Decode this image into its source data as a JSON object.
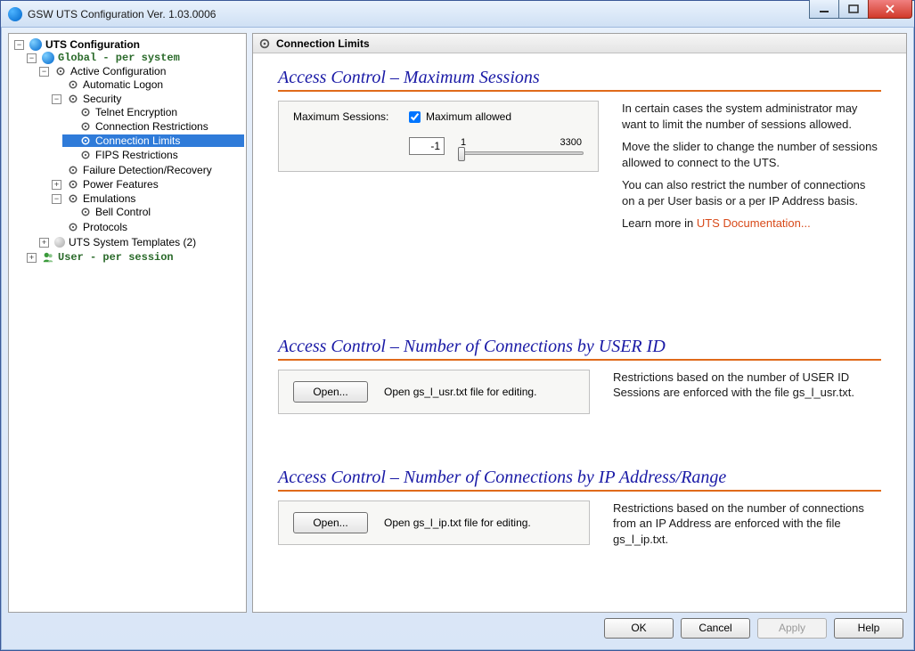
{
  "window": {
    "title": "GSW UTS Configuration     Ver. 1.03.0006"
  },
  "tree": {
    "root": "UTS Configuration",
    "global": "Global  - per system",
    "active_config": "Active Configuration",
    "automatic_logon": "Automatic Logon",
    "security": "Security",
    "telnet_encryption": "Telnet Encryption",
    "connection_restrictions": "Connection Restrictions",
    "connection_limits": "Connection Limits",
    "fips_restrictions": "FIPS Restrictions",
    "failure_detection": "Failure Detection/Recovery",
    "power_features": "Power Features",
    "emulations": "Emulations",
    "bell_control": "Bell Control",
    "protocols": "Protocols",
    "uts_templates": "UTS System Templates (2)",
    "user": "User   - per session"
  },
  "header": {
    "title": "Connection Limits"
  },
  "section1": {
    "title": "Access Control – Maximum Sessions",
    "label": "Maximum Sessions:",
    "checkbox_label": "Maximum allowed",
    "checkbox_checked": true,
    "value": "-1",
    "slider_min": "1",
    "slider_max": "3300",
    "desc1": "In certain cases the system administrator may want to limit the number of sessions allowed.",
    "desc2": "Move the slider to change the number of sessions allowed to connect to the UTS.",
    "desc3": "You can also restrict the number of connections on a per User basis or a per IP Address basis.",
    "desc4_prefix": "Learn more in ",
    "desc4_link": "UTS Documentation..."
  },
  "section2": {
    "title": "Access Control – Number of Connections by USER ID",
    "button": "Open...",
    "caption": "Open gs_l_usr.txt file for editing.",
    "desc": "Restrictions based on the number of USER ID Sessions are enforced with the file gs_l_usr.txt."
  },
  "section3": {
    "title": "Access Control – Number of Connections by IP Address/Range",
    "button": "Open...",
    "caption": "Open gs_l_ip.txt file for editing.",
    "desc": "Restrictions based on the number of connections from an IP Address are enforced with the file gs_l_ip.txt."
  },
  "buttons": {
    "ok": "OK",
    "cancel": "Cancel",
    "apply": "Apply",
    "help": "Help"
  }
}
